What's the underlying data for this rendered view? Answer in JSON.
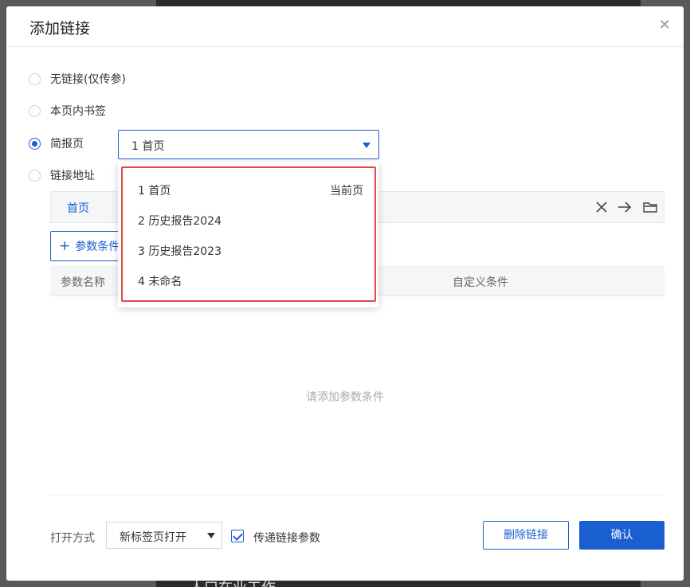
{
  "dialog": {
    "title": "添加链接",
    "close_icon": "close-icon"
  },
  "link_types": [
    {
      "label": "无链接(仅传参)",
      "checked": false
    },
    {
      "label": "本页内书签",
      "checked": false
    },
    {
      "label": "简报页",
      "checked": true
    },
    {
      "label": "链接地址",
      "checked": false
    }
  ],
  "page_select": {
    "value": "1 首页"
  },
  "page_options": [
    {
      "label": "1 首页",
      "badge": "当前页"
    },
    {
      "label": "2 历史报告2024",
      "badge": ""
    },
    {
      "label": "3 历史报告2023",
      "badge": ""
    },
    {
      "label": "4 未命名",
      "badge": ""
    }
  ],
  "link_bar": {
    "text": "首页",
    "icons": [
      "clear-icon",
      "arrow-right-icon",
      "folder-icon"
    ]
  },
  "params": {
    "add_button": "参数条件",
    "col_name": "参数名称",
    "col_custom": "自定义条件",
    "empty_text": "请添加参数条件"
  },
  "footer": {
    "open_mode_label": "打开方式",
    "open_mode_value": "新标签页打开",
    "pass_params_label": "传递链接参数",
    "pass_params_checked": true,
    "delete_button": "删除链接",
    "confirm_button": "确认"
  },
  "backdrop": {
    "text": "人口在业工作"
  },
  "colors": {
    "accent": "#1a5fd0",
    "highlight": "#e04a3f"
  }
}
